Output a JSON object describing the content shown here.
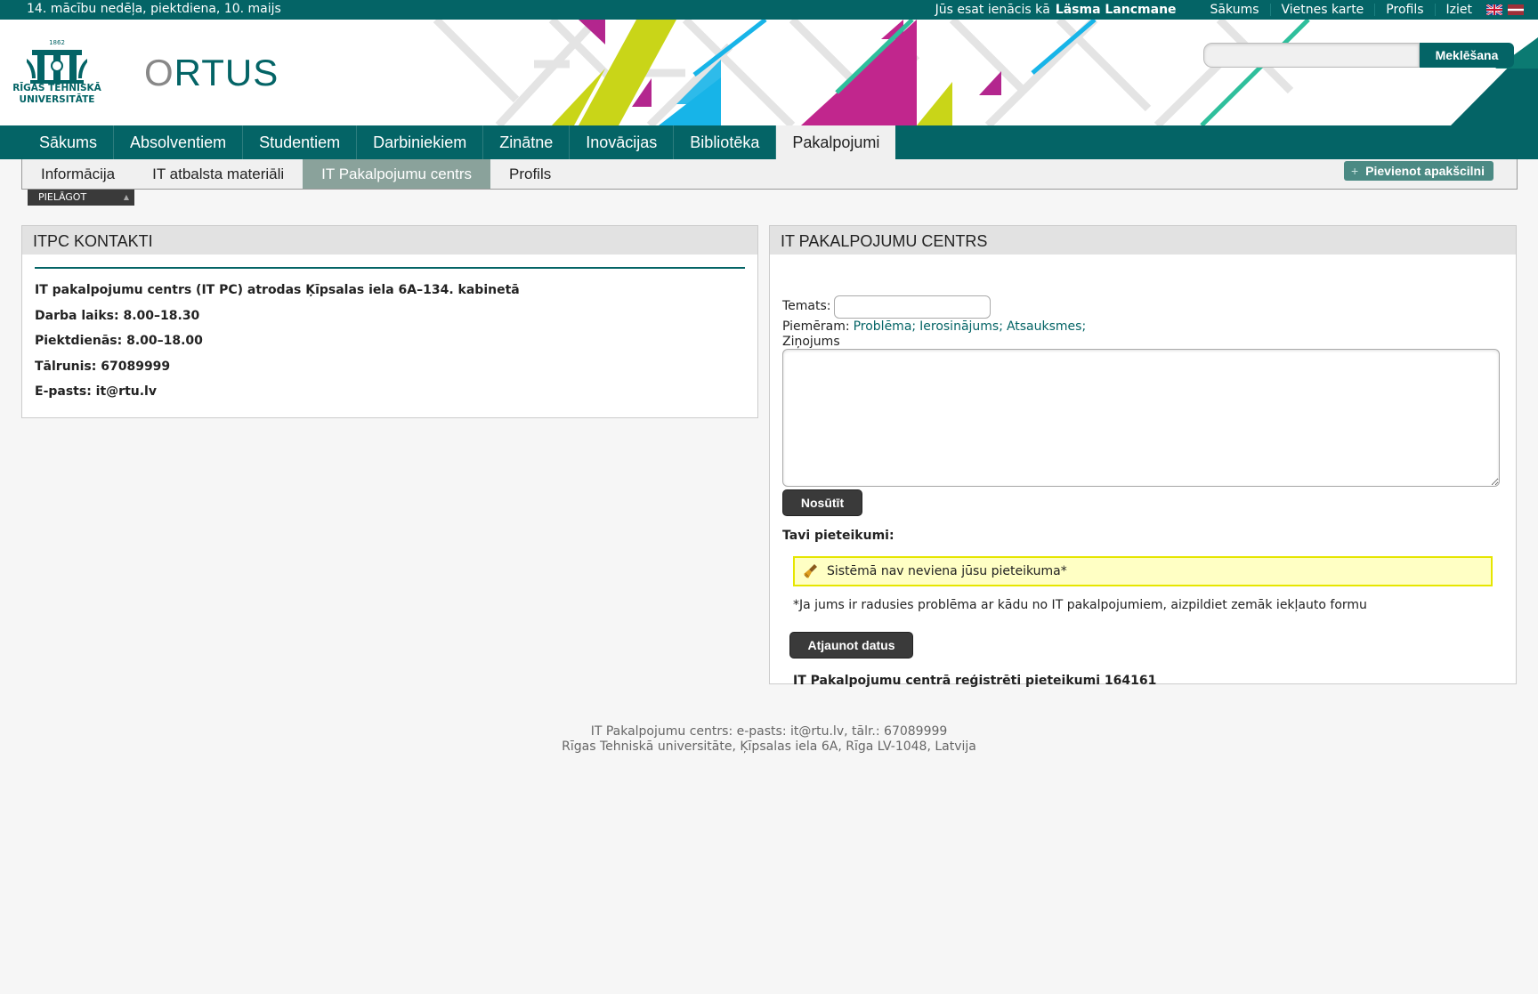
{
  "topbar": {
    "date": "14. mācību nedēļa, piektdiena, 10. maijs",
    "logged_prefix": "Jūs esat ienācis kā",
    "user": "Läsma Lancmane",
    "links": [
      "Sākums",
      "Vietnes karte",
      "Profils",
      "Iziet"
    ]
  },
  "header": {
    "logo_year": "1862",
    "logo_line1": "RĪGAS TEHNISKĀ",
    "logo_line2": "UNIVERSITĀTE",
    "brand_o": "O",
    "brand_rest": "RTUS",
    "search_button": "Meklēšana"
  },
  "mainnav": [
    "Sākums",
    "Absolventiem",
    "Studentiem",
    "Darbiniekiem",
    "Zinātne",
    "Inovācijas",
    "Bibliotēka",
    "Pakalpojumi"
  ],
  "subnav": [
    "Informācija",
    "IT atbalsta materiāli",
    "IT Pakalpojumu centrs",
    "Profils"
  ],
  "add_button": "Pievienot apakšcilni",
  "pielagot": "PIELĀGOT",
  "left_panel": {
    "title": "ITPC KONTAKTI",
    "lines": [
      "IT pakalpojumu centrs (IT PC) atrodas Ķīpsalas iela 6A–134. kabinetā",
      "Darba laiks: 8.00–18.30",
      "Piektdienās: 8.00–18.00",
      "Tālrunis: 67089999",
      "E-pasts: it@rtu.lv"
    ]
  },
  "right_panel": {
    "title": "IT PAKALPOJUMU CENTRS",
    "subject_label": "Temats:",
    "subject_value": "",
    "example_label": "Piemēram:",
    "examples": [
      "Problēma;",
      "Ierosinājums;",
      "Atsauksmes;"
    ],
    "message_label": "Ziņojums",
    "send_button": "Nosūtīt",
    "requests_label": "Tavi pieteikumi:",
    "notice": "Sistēmā nav neviena jūsu pieteikuma*",
    "hint": "*Ja jums ir radusies problēma ar kādu no IT pakalpojumiem, aizpildiet zemāk iekļauto formu",
    "refresh_button": "Atjaunot datus",
    "registered_text": "IT Pakalpojumu centrā reģistrēti pieteikumi",
    "registered_count": "164161"
  },
  "footer": {
    "line1": "IT Pakalpojumu centrs: e-pasts: it@rtu.lv, tālr.: 67089999",
    "line2": "Rīgas Tehniskā universitāte, Ķīpsalas iela 6A, Rīga LV-1048, Latvija"
  },
  "colors": {
    "brand": "#046466",
    "notice_bg": "#ffffc4",
    "active_subtab": "#8aa29b"
  }
}
